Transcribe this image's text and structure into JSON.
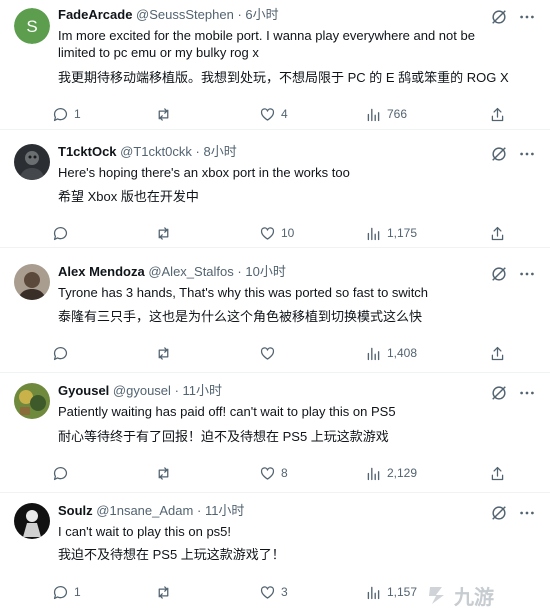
{
  "posts": [
    {
      "name": "FadeArcade",
      "handle": "@SeussStephen",
      "time": "6小时",
      "avatar_letter": "S",
      "avatar_color": "#5c9e4e",
      "text": "Im more excited for the mobile port. I wanna play everywhere and not be limited to pc emu or my bulky rog x",
      "translation": "我更期待移动端移植版。我想到处玩，不想局限于 PC 的 E 鸹或笨重的 ROG X",
      "replies": "1",
      "retweets": "",
      "likes": "4",
      "views": "766"
    },
    {
      "name": "T1cktOck",
      "handle": "@T1ckt0ckk",
      "time": "8小时",
      "text": "Here's hoping there's an xbox port in the works too",
      "translation": "希望 Xbox 版也在开发中",
      "replies": "",
      "retweets": "",
      "likes": "10",
      "views": "1,175"
    },
    {
      "name": "Alex Mendoza",
      "handle": "@Alex_Stalfos",
      "time": "10小时",
      "text": "Tyrone has 3 hands, That's why this was ported so fast to switch",
      "translation": "泰隆有三只手，这也是为什么这个角色被移植到切换模式这么快",
      "replies": "",
      "retweets": "",
      "likes": "",
      "views": "1,408"
    },
    {
      "name": "Gyousel",
      "handle": "@gyousel",
      "time": "11小时",
      "text": "Patiently waiting has paid off! can't wait to play this on PS5",
      "translation": "耐心等待终于有了回报！迫不及待想在 PS5 上玩这款游戏",
      "replies": "",
      "retweets": "",
      "likes": "8",
      "views": "2,129"
    },
    {
      "name": "Soulz",
      "handle": "@1nsane_Adam",
      "time": "11小时",
      "text": "I can't wait to play this on ps5!",
      "translation": "我迫不及待想在 PS5 上玩这款游戏了！",
      "replies": "1",
      "retweets": "",
      "likes": "3",
      "views": "1,157"
    }
  ],
  "separator": "·",
  "watermark": "九游"
}
